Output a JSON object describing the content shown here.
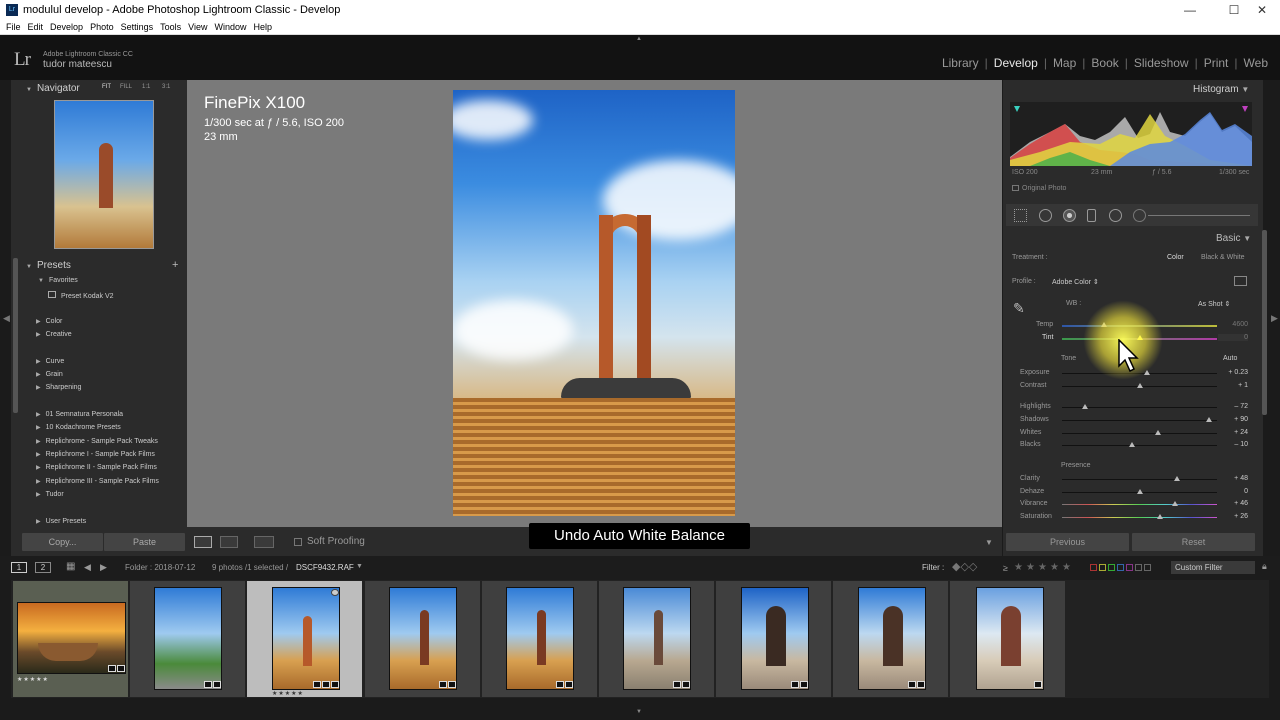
{
  "window": {
    "title": "modulul develop - Adobe Photoshop Lightroom Classic - Develop",
    "icon_label": "Lr",
    "controls": [
      "—",
      "☐",
      "✕"
    ]
  },
  "menu": [
    "File",
    "Edit",
    "Develop",
    "Photo",
    "Settings",
    "Tools",
    "View",
    "Window",
    "Help"
  ],
  "identity": {
    "logo": "Lr",
    "line1": "Adobe Lightroom Classic CC",
    "line2": "tudor mateescu"
  },
  "modules": [
    "Library",
    "Develop",
    "Map",
    "Book",
    "Slideshow",
    "Print",
    "Web"
  ],
  "active_module": "Develop",
  "navigator": {
    "title": "Navigator",
    "zoom_options": [
      "FIT",
      "FILL",
      "1:1",
      "3:1"
    ]
  },
  "presets": {
    "title": "Presets",
    "add_label": "+",
    "favorites_label": "Favorites",
    "favorite_item": "Preset Kodak V2",
    "groups_a": [
      "Color",
      "Creative"
    ],
    "groups_b": [
      "Curve",
      "Grain",
      "Sharpening"
    ],
    "groups_c": [
      "01 Semnatura Personala",
      "10 Kodachrome Presets",
      "Replichrome - Sample Pack Tweaks",
      "Replichrome I - Sample Pack Films",
      "Replichrome II - Sample Pack Films",
      "Replichrome III - Sample Pack Films",
      "Tudor"
    ],
    "user_presets": "User Presets"
  },
  "left_buttons": {
    "copy": "Copy...",
    "paste": "Paste"
  },
  "photo_info": {
    "camera": "FinePix X100",
    "exposure": "1/300 sec at ƒ / 5.6, ISO 200",
    "focal": "23 mm"
  },
  "toolbar": {
    "soft_proofing": "Soft Proofing"
  },
  "toast": "Undo Auto White Balance",
  "histogram": {
    "title": "Histogram",
    "iso": "ISO 200",
    "focal": "23 mm",
    "aperture": "ƒ / 5.6",
    "shutter": "1/300 sec",
    "original_photo": "Original Photo"
  },
  "basic": {
    "title": "Basic",
    "treatment_label": "Treatment :",
    "treatment_color": "Color",
    "treatment_bw": "Black & White",
    "profile_label": "Profile :",
    "profile_value": "Adobe Color ⇕",
    "wb_label": "WB :",
    "wb_value": "As Shot ⇕",
    "temp_label": "Temp",
    "temp_value": "4600",
    "tint_label": "Tint",
    "tint_value": "0",
    "tone_label": "Tone",
    "auto_label": "Auto",
    "presence_label": "Presence",
    "sliders": [
      {
        "label": "Exposure",
        "value": "+ 0.23",
        "level": 0.55
      },
      {
        "label": "Contrast",
        "value": "+ 1",
        "level": 0.5
      },
      {
        "label": "Highlights",
        "value": "– 72",
        "level": 0.15
      },
      {
        "label": "Shadows",
        "value": "+ 90",
        "level": 0.95
      },
      {
        "label": "Whites",
        "value": "+ 24",
        "level": 0.62
      },
      {
        "label": "Blacks",
        "value": "– 10",
        "level": 0.45
      },
      {
        "label": "Clarity",
        "value": "+ 48",
        "level": 0.74
      },
      {
        "label": "Dehaze",
        "value": "0",
        "level": 0.5
      },
      {
        "label": "Vibrance",
        "value": "+ 46",
        "level": 0.73
      },
      {
        "label": "Saturation",
        "value": "+ 26",
        "level": 0.63
      }
    ],
    "temp_level": 0.27,
    "tint_level": 0.5
  },
  "right_buttons": {
    "previous": "Previous",
    "reset": "Reset"
  },
  "filmstrip_bar": {
    "page1": "1",
    "page2": "2",
    "folder": "Folder : 2018-07-12",
    "count": "9 photos /1 selected /",
    "filename": "DSCF9432.RAF",
    "filter_label": "Filter :",
    "rating_op": "≥",
    "custom_filter": "Custom Filter"
  },
  "filmstrip": {
    "rating_first": "★★★★★",
    "rating_selected": "★★★★★"
  },
  "colors": {
    "accent_yellow": "#ffff5a",
    "panel": "#2b2b2b",
    "canvas": "#7a7a7a"
  }
}
